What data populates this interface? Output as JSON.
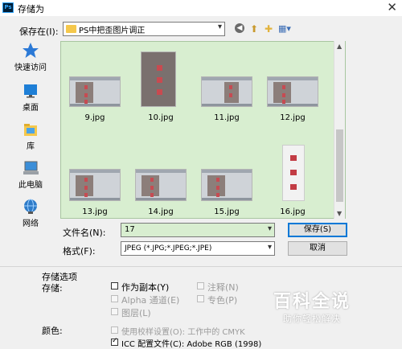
{
  "window": {
    "app_icon_text": "Ps",
    "title": "存储为",
    "close_glyph": "✕"
  },
  "location": {
    "label": "保存在(I):",
    "value": "PS中把歪图片调正"
  },
  "sidebar": {
    "items": [
      {
        "label": "快速访问",
        "icon": "star-icon"
      },
      {
        "label": "桌面",
        "icon": "desktop-icon"
      },
      {
        "label": "库",
        "icon": "library-icon"
      },
      {
        "label": "此电脑",
        "icon": "computer-icon"
      },
      {
        "label": "网络",
        "icon": "network-icon"
      }
    ]
  },
  "files": [
    {
      "name": "9.jpg",
      "kind": "screenshot"
    },
    {
      "name": "10.jpg",
      "kind": "portrait"
    },
    {
      "name": "11.jpg",
      "kind": "screenshot"
    },
    {
      "name": "12.jpg",
      "kind": "screenshot"
    },
    {
      "name": "13.jpg",
      "kind": "screenshot"
    },
    {
      "name": "14.jpg",
      "kind": "screenshot"
    },
    {
      "name": "15.jpg",
      "kind": "screenshot"
    },
    {
      "name": "16.jpg",
      "kind": "portrait-white"
    }
  ],
  "filename": {
    "label": "文件名(N):",
    "value": "17"
  },
  "format": {
    "label": "格式(F):",
    "value": "JPEG (*.JPG;*.JPEG;*.JPE)"
  },
  "buttons": {
    "save": "保存(S)",
    "cancel": "取消"
  },
  "options": {
    "section_title": "存储选项",
    "save_label": "存储:",
    "as_copy": "作为副本(Y)",
    "alpha": "Alpha 通道(E)",
    "layers": "图层(L)",
    "notes": "注释(N)",
    "spot": "专色(P)",
    "color_label": "颜色:",
    "proof": "使用校样设置(O): 工作中的 CMYK",
    "icc": "ICC 配置文件(C): Adobe RGB (1998)"
  },
  "watermark": {
    "title": "百科全说",
    "subtitle": "助你轻松解决"
  },
  "colors": {
    "pane_bg": "#d8eed0",
    "accent": "#0078d7"
  }
}
